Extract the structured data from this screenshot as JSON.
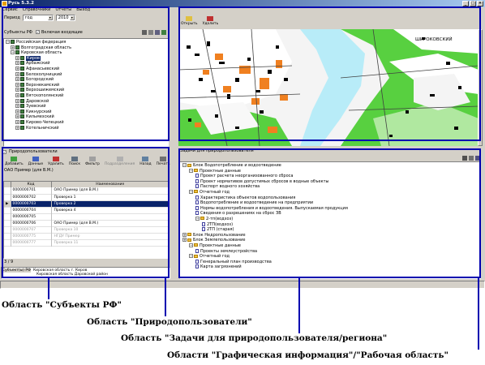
{
  "window": {
    "title": "Русь 5.3.2"
  },
  "menu": [
    "Сервис",
    "Справочники",
    "Отчеты",
    "Выход"
  ],
  "period": {
    "label": "Период",
    "type_value": "год",
    "year_value": "2010"
  },
  "subjects_panel": {
    "title": "Субъекты РФ",
    "include_children": "Включая входящие",
    "root": "Российская федерация",
    "items": [
      "Волгоградская область",
      "Кировская область",
      "Киров",
      "Арбажский",
      "Афанасьевский",
      "Белохолуницкий",
      "Богородский",
      "Верхнекамский",
      "Верхошижемский",
      "Вятскополянский",
      "Даровской",
      "Зуевский",
      "Кикнурский",
      "Кильмезский",
      "Кирово-Чепецкий",
      "Котельничский"
    ]
  },
  "nature_users_panel": {
    "title": "Природопользователи",
    "toolbar": [
      "Добавить",
      "Данные",
      "Удалить",
      "Поиск",
      "Фильтр",
      "Подразделения",
      "Назад",
      "Печать"
    ],
    "current": "ОАО Пример (для В.М.)",
    "columns": [
      "Код",
      "Наименование"
    ],
    "rows": [
      {
        "code": "0000000701",
        "name": "ОАО Пример (для В.М.)"
      },
      {
        "code": "0000000702",
        "name": "Проверка 1"
      },
      {
        "code": "0000000703",
        "name": "Проверка 2"
      },
      {
        "code": "0000000704",
        "name": "Проверка 4"
      },
      {
        "code": "0000000705",
        "name": ""
      },
      {
        "code": "0000000706",
        "name": "ОАО Пример (для В.М.)"
      },
      {
        "code": "0000000707",
        "name": "Проверка 10"
      },
      {
        "code": "0000000775",
        "name": "НГДУ Пример"
      },
      {
        "code": "0000000777",
        "name": "Проверка 11"
      }
    ],
    "pager": "3 / 9"
  },
  "bottom_strip": {
    "label": "Субъект(ы) РФ",
    "line1": "Кировская область г. Киров",
    "line2": "Кировская область Даровской район"
  },
  "graphics_panel": {
    "toolbar": [
      "Открыть",
      "Удалить"
    ],
    "map_label": "ШИРОКОВСКИЙ"
  },
  "tasks_panel": {
    "title": "Задачи для природопользователя",
    "tree": [
      {
        "level": 0,
        "icon": "folder",
        "text": "Блок Водопотребление и водоотведение"
      },
      {
        "level": 1,
        "icon": "folder",
        "text": "Проектные данные"
      },
      {
        "level": 2,
        "icon": "doc",
        "text": "Проект расчета неорганизованного сброса"
      },
      {
        "level": 2,
        "icon": "doc",
        "text": "Проект нормативов допустимых сбросов в водные объекты"
      },
      {
        "level": 2,
        "icon": "doc",
        "text": "Паспорт водного хозяйства"
      },
      {
        "level": 1,
        "icon": "folder",
        "text": "Отчетный год"
      },
      {
        "level": 2,
        "icon": "doc",
        "text": "Характеристика объектов водопользования"
      },
      {
        "level": 2,
        "icon": "doc",
        "text": "Водопотребление и водоотведение на предприятии"
      },
      {
        "level": 2,
        "icon": "doc",
        "text": "Нормы водопотребления и водоотведения. Выпускаемая продукция"
      },
      {
        "level": 2,
        "icon": "doc",
        "text": "Сведения о разрешениях на сброс ЗВ"
      },
      {
        "level": 2,
        "icon": "folder",
        "text": "2-тп(водхоз)"
      },
      {
        "level": 3,
        "icon": "doc",
        "text": "2ТП(водхоз)"
      },
      {
        "level": 3,
        "icon": "doc",
        "text": "2ТП (старая)"
      },
      {
        "level": 0,
        "icon": "folder",
        "text": "Блок Недропользование"
      },
      {
        "level": 0,
        "icon": "folder",
        "text": "Блок Землепользование"
      },
      {
        "level": 1,
        "icon": "folder",
        "text": "Проектные данные"
      },
      {
        "level": 2,
        "icon": "doc",
        "text": "Проекты землеустройства"
      },
      {
        "level": 1,
        "icon": "folder",
        "text": "Отчетный год"
      },
      {
        "level": 2,
        "icon": "doc",
        "text": "Генеральный план производства"
      },
      {
        "level": 2,
        "icon": "doc",
        "text": "Карта загрязнений"
      }
    ]
  },
  "annotations": {
    "a1": "Область \"Субъекты РФ\"",
    "a2": "Область \"Природопользователи\"",
    "a3": "Область \"Задачи для природопользователя/региона\"",
    "a4": "Области \"Графическая информация\"/\"Рабочая область\""
  },
  "colors": {
    "callout": "#0000b0",
    "selection": "#0a246a",
    "titlebar": "#0a246a"
  }
}
